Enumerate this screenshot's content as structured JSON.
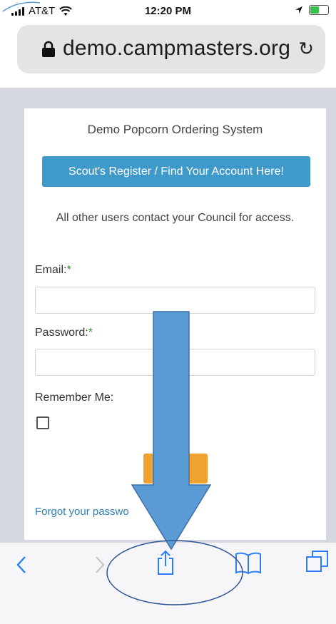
{
  "status_bar": {
    "carrier": "AT&T",
    "time": "12:20 PM",
    "battery_level": 0.55,
    "battery_color": "#36c24a"
  },
  "browser": {
    "url": "demo.campmasters.org",
    "lock_icon": "lock-icon",
    "reload_icon": "reload-icon"
  },
  "page": {
    "system_title": "Demo Popcorn Ordering System",
    "register_button": "Scout's Register / Find Your Account Here!",
    "contact_text": "All other users contact your Council for access.",
    "email_label": "Email:",
    "password_label": "Password:",
    "required_mark": "*",
    "email_value": "",
    "password_value": "",
    "remember_label": "Remember Me:",
    "remember_checked": false,
    "login_button": "",
    "forgot_link": "Forgot your passwo",
    "colors": {
      "register": "#3f9ac9",
      "login": "#f0a230",
      "link": "#2f7fb5",
      "required": "#2e8b2e"
    }
  },
  "toolbar": {
    "icons": [
      "back-icon",
      "forward-icon",
      "share-icon",
      "bookmarks-icon",
      "tabs-icon"
    ]
  },
  "annotations": {
    "arrow_color": "#5b9bd5",
    "ellipse_color": "#2f5597"
  }
}
